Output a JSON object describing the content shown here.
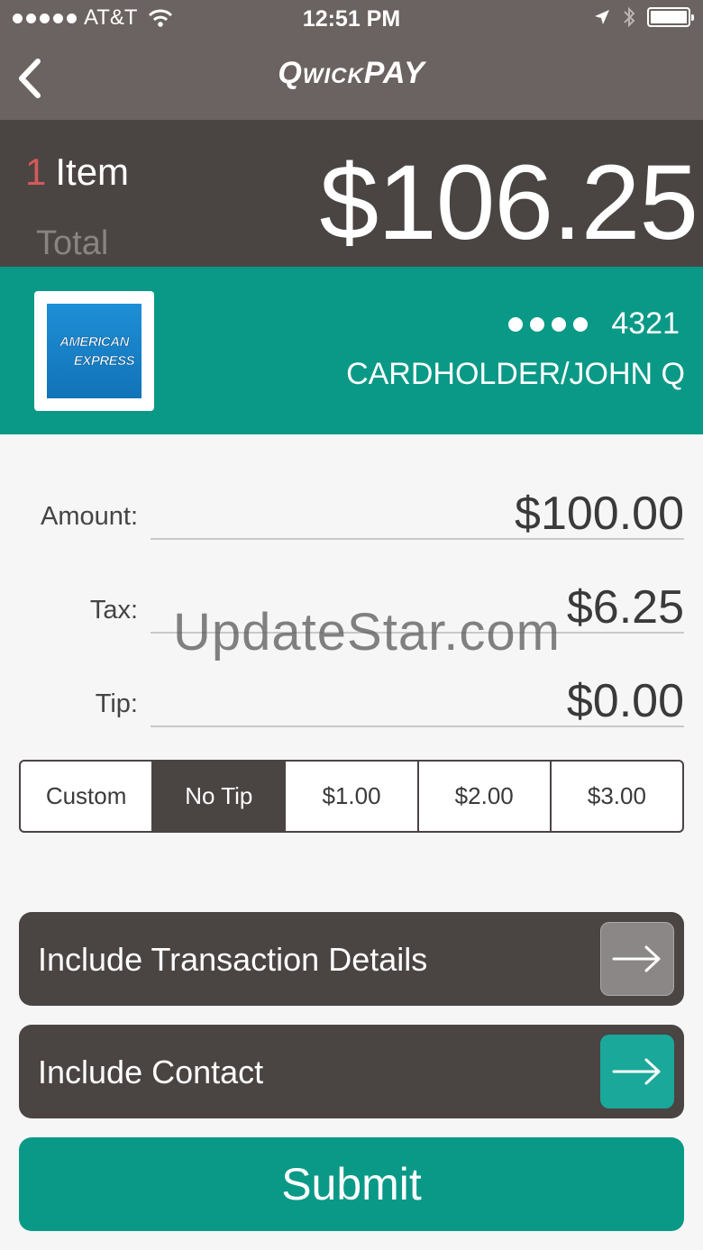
{
  "status": {
    "carrier": "AT&T",
    "time": "12:51 PM"
  },
  "nav": {
    "title": "QwickPAY"
  },
  "summary": {
    "item_count": "1",
    "item_label": "Item",
    "total_label": "Total",
    "total_amount": "$106.25"
  },
  "card": {
    "brand_line1": "AMERICAN",
    "brand_line2": "EXPRESS",
    "last4": "4321",
    "holder": "CARDHOLDER/JOHN Q"
  },
  "fields": {
    "amount": {
      "label": "Amount:",
      "value": "$100.00"
    },
    "tax": {
      "label": "Tax:",
      "value": "$6.25"
    },
    "tip": {
      "label": "Tip:",
      "value": "$0.00"
    }
  },
  "tip_options": [
    "Custom",
    "No Tip",
    "$1.00",
    "$2.00",
    "$3.00"
  ],
  "tip_selected": "No Tip",
  "actions": {
    "details": "Include Transaction Details",
    "contact": "Include Contact",
    "submit": "Submit"
  },
  "watermark": "UpdateStar.com",
  "colors": {
    "teal": "#0a9987",
    "dark": "#4a4443",
    "nav": "#6b6361",
    "accent_red": "#d45a5a"
  }
}
